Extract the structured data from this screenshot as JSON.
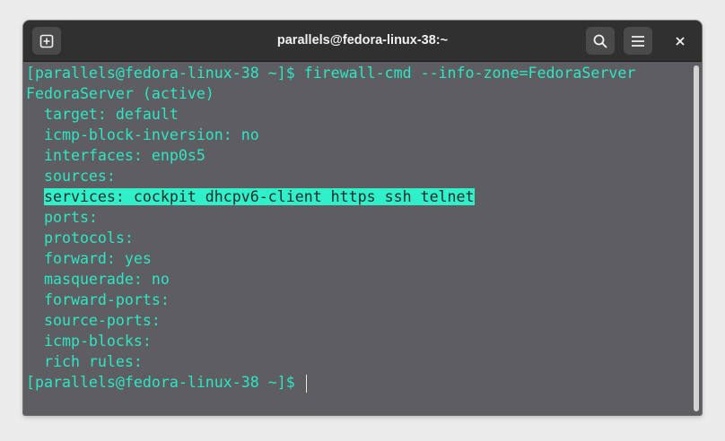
{
  "window": {
    "title": "parallels@fedora-linux-38:~"
  },
  "toolbar": {
    "new_tab_icon": "new-tab-icon",
    "search_icon": "search-icon",
    "menu_icon": "hamburger-menu-icon",
    "close_icon": "close-icon"
  },
  "terminal": {
    "prompt1": "[parallels@fedora-linux-38 ~]$ ",
    "command": "firewall-cmd --info-zone=FedoraServer",
    "output": [
      "FedoraServer (active)",
      "  target: default",
      "  icmp-block-inversion: no",
      "  interfaces: enp0s5",
      "  sources: ",
      "  services: cockpit dhcpv6-client https ssh telnet",
      "  ports: ",
      "  protocols: ",
      "  forward: yes",
      "  masquerade: no",
      "  forward-ports: ",
      "  source-ports: ",
      "  icmp-blocks: ",
      "  rich rules: "
    ],
    "prompt2": "[parallels@fedora-linux-38 ~]$ "
  },
  "colors": {
    "text": "#2ce6c4",
    "highlight": "#2ff0c8",
    "background": "#5e5e62",
    "titlebar": "#303030"
  }
}
